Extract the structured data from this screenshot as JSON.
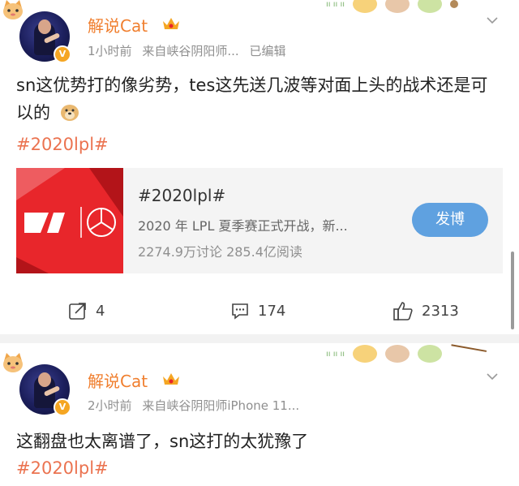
{
  "posts": [
    {
      "author": "解说Cat",
      "time": "1小时前",
      "source_prefix": "来自",
      "source": "峡谷阴阳师...",
      "edited": "已编辑",
      "text": "sn这优势打的像劣势，tes这先送几波等对面上头的战术还是可以的",
      "hashtag": "#2020lpl#",
      "card": {
        "title": "#2020lpl#",
        "description": "2020 年 LPL 夏季赛正式开战，新...",
        "stats": "2274.9万讨论   285.4亿阅读",
        "button": "发博"
      },
      "actions": {
        "reposts": "4",
        "comments": "174",
        "likes": "2313"
      }
    },
    {
      "author": "解说Cat",
      "time": "2小时前",
      "source_prefix": "来自",
      "source": "峡谷阴阳师iPhone 11...",
      "text": "这翻盘也太离谱了，sn这打的太犹豫了",
      "hashtag": "#2020lpl#"
    }
  ],
  "icons": {
    "verified": "verified-v-icon",
    "crown": "crown-badge-icon",
    "repost": "repost-icon",
    "comment": "comment-icon",
    "like": "thumbs-up-icon",
    "menu": "chevron-down-icon",
    "emoji": "doge-emoji-icon"
  },
  "colors": {
    "name": "#f07f2f",
    "hashtag": "#eb7350",
    "button": "#5fa1e0",
    "card_image": "#e8262b"
  }
}
